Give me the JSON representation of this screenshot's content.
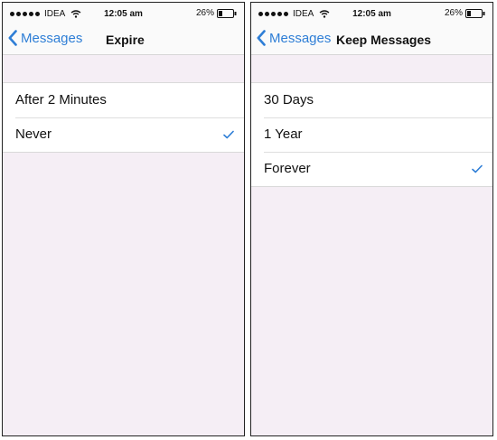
{
  "colors": {
    "accent": "#2e7ed6",
    "background": "#f5eef5",
    "bar": "#fafafa",
    "cell": "#ffffff"
  },
  "left": {
    "status": {
      "carrier": "IDEA",
      "time": "12:05 am",
      "battery": "26%"
    },
    "nav": {
      "back_label": "Messages",
      "title": "Expire"
    },
    "options": [
      {
        "label": "After 2 Minutes",
        "selected": false
      },
      {
        "label": "Never",
        "selected": true
      }
    ]
  },
  "right": {
    "status": {
      "carrier": "IDEA",
      "time": "12:05 am",
      "battery": "26%"
    },
    "nav": {
      "back_label": "Messages",
      "title": "Keep Messages"
    },
    "options": [
      {
        "label": "30 Days",
        "selected": false
      },
      {
        "label": "1 Year",
        "selected": false
      },
      {
        "label": "Forever",
        "selected": true
      }
    ]
  }
}
